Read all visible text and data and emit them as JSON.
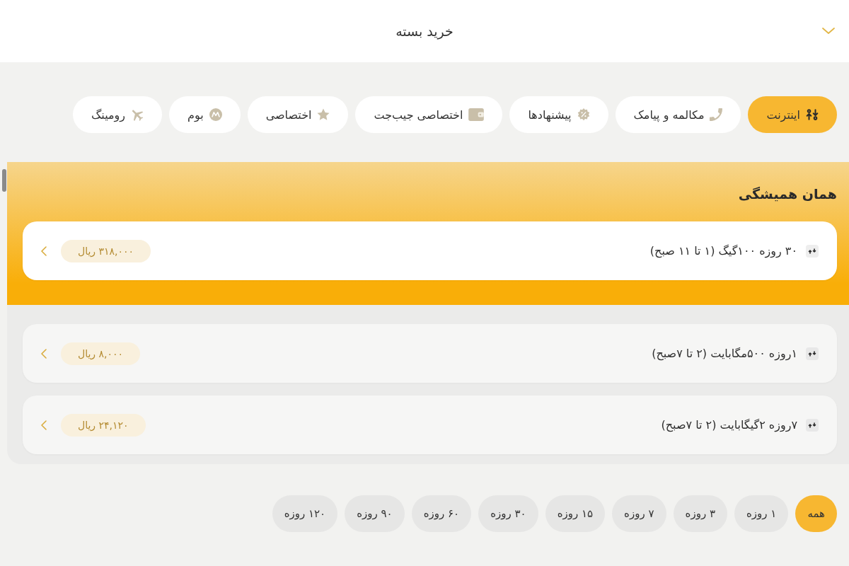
{
  "header": {
    "title": "خرید بسته"
  },
  "categories": [
    {
      "label": "اینترنت",
      "selected": true
    },
    {
      "label": "مکالمه و پیامک",
      "selected": false
    },
    {
      "label": "پیشنهادها",
      "selected": false
    },
    {
      "label": "اختصاصی جیب‌جت",
      "selected": false
    },
    {
      "label": "اختصاصی",
      "selected": false
    },
    {
      "label": "بوم",
      "selected": false
    },
    {
      "label": "رومینگ",
      "selected": false
    }
  ],
  "featured": {
    "title": "همان همیشگی",
    "packages": [
      {
        "name": "۳۰ روزه ۱۰۰گیگ (۱ تا ۱۱ صبح)",
        "price": "۳۱۸,۰۰۰ ریال"
      }
    ]
  },
  "packages": [
    {
      "name": "۱روزه ۵۰۰مگابایت (۲ تا ۷صبح)",
      "price": "۸,۰۰۰ ریال"
    },
    {
      "name": "۷روزه ۲گیگابایت (۲ تا ۷صبح)",
      "price": "۲۴,۱۲۰ ریال"
    }
  ],
  "duration_filters": [
    {
      "label": "همه",
      "selected": true
    },
    {
      "label": "۱ روزه",
      "selected": false
    },
    {
      "label": "۳ روزه",
      "selected": false
    },
    {
      "label": "۷ روزه",
      "selected": false
    },
    {
      "label": "۱۵ روزه",
      "selected": false
    },
    {
      "label": "۳۰ روزه",
      "selected": false
    },
    {
      "label": "۶۰ روزه",
      "selected": false
    },
    {
      "label": "۹۰ روزه",
      "selected": false
    },
    {
      "label": "۱۲۰ روزه",
      "selected": false
    }
  ]
}
